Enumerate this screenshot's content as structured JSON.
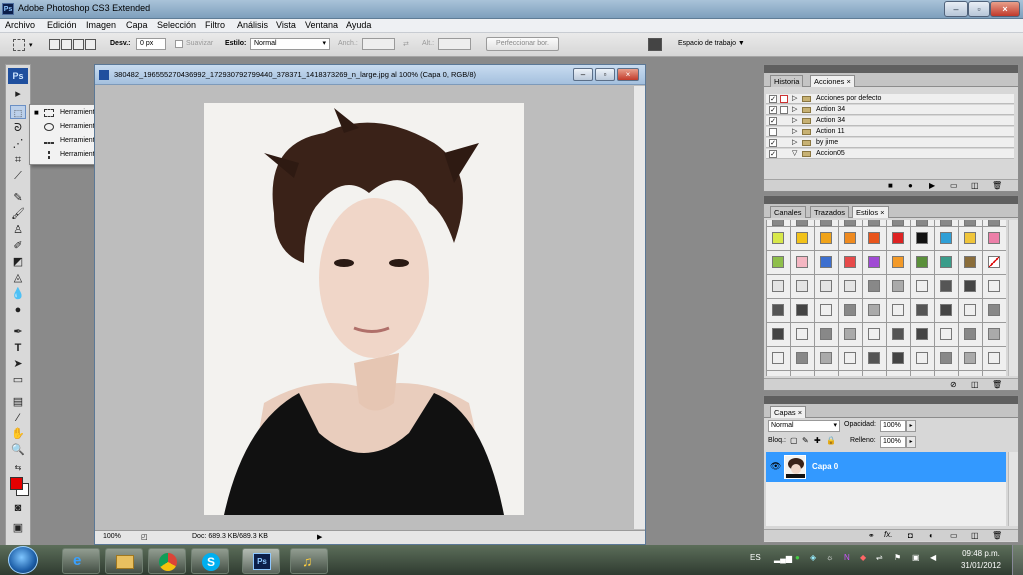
{
  "window": {
    "title": "Adobe Photoshop CS3 Extended",
    "app_icon": "Ps"
  },
  "menu": [
    "Archivo",
    "Edición",
    "Imagen",
    "Capa",
    "Selección",
    "Filtro",
    "Análisis",
    "Vista",
    "Ventana",
    "Ayuda"
  ],
  "options_bar": {
    "feather_label": "Desv.:",
    "feather_value": "0 px",
    "antialias_label": "Suavizar",
    "style_label": "Estilo:",
    "style_value": "Normal",
    "width_label": "Anch.:",
    "height_label": "Alt.:",
    "refine_edge": "Perfeccionar bor.",
    "workspace": "Espacio de trabajo ▼"
  },
  "toolbar": {
    "logo": "Ps"
  },
  "flyout": [
    {
      "label": "Herramienta Marco rectangular",
      "shortcut": "M",
      "selected": true
    },
    {
      "label": "Herramienta Marco elíptico",
      "shortcut": "M",
      "selected": false
    },
    {
      "label": "Herramienta Marco fila única",
      "shortcut": "",
      "selected": false
    },
    {
      "label": "Herramienta Marco columna única",
      "shortcut": "",
      "selected": false
    }
  ],
  "document": {
    "title": "380482_196555270436992_172930792799440_378371_1418373269_n_large.jpg al 100% (Capa 0, RGB/8)",
    "zoom": "100%",
    "doc_info": "Doc: 689.3 KB/689.3 KB"
  },
  "panels": {
    "history_tab": "Historia",
    "actions_tab": "Acciones ×",
    "actions": [
      {
        "name": "Acciones por defecto",
        "checked": true
      },
      {
        "name": "Action 34",
        "checked": true
      },
      {
        "name": "Action 34",
        "checked": true
      },
      {
        "name": "Action 11",
        "checked": false
      },
      {
        "name": "by jime",
        "checked": true
      },
      {
        "name": "Accion05",
        "checked": true
      }
    ],
    "channels_tab": "Canales",
    "paths_tab": "Trazados",
    "styles_tab": "Estilos ×",
    "style_colors_row1": [
      "#d8e84a",
      "#f2c21a",
      "#f0a319",
      "#ef8a1f",
      "#e8551c",
      "#dd2222",
      "#111111",
      "#2f9fd6",
      "#f0c53a",
      "#ec7fa8"
    ],
    "style_colors_row2": [
      "#8fbf4b",
      "#f4b6c2",
      "#3d6fcf",
      "#e64a4a",
      "#a04ad4",
      "#f39a29",
      "#5a8f3a",
      "#3a9c8a",
      "#8a6d3a",
      "#ffffff"
    ],
    "layers_tab": "Capas ×",
    "blend_mode": "Normal",
    "opacity_label": "Opacidad:",
    "opacity_value": "100%",
    "lock_label": "Bloq.:",
    "fill_label": "Relleno:",
    "fill_value": "100%",
    "layer_name": "Capa 0"
  },
  "taskbar": {
    "lang": "ES",
    "time": "09:48 p.m.",
    "date": "31/01/2012"
  },
  "colors": {
    "foreground": "#e60000",
    "background": "#ffffff",
    "layer_highlight": "#3399ff"
  }
}
